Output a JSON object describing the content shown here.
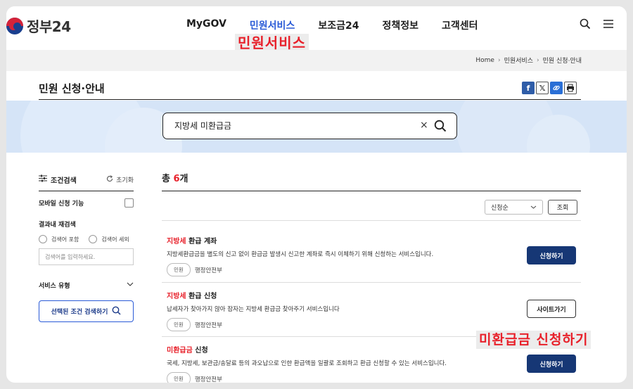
{
  "header": {
    "logo_text": "정부24",
    "nav": [
      "MyGOV",
      "민원서비스",
      "보조금24",
      "정책정보",
      "고객센터"
    ],
    "active_nav": "민원서비스",
    "icons": [
      "search-icon",
      "menu-icon"
    ]
  },
  "annotations": {
    "top": "민원서비스",
    "bottom": "미환급금 신청하기"
  },
  "breadcrumb": [
    "Home",
    "민원서비스",
    "민원 신청·안내"
  ],
  "page": {
    "title": "민원 신청·안내",
    "share_icons": [
      "facebook-icon",
      "x-icon",
      "link-icon",
      "print-icon"
    ]
  },
  "search": {
    "value": "지방세 미환급금",
    "clear": "×"
  },
  "sidebar": {
    "heading": "조건검색",
    "reset": "초기화",
    "mobile_label": "모바일 신청 기능",
    "result_search_label": "결과내 재검색",
    "include_label": "검색어 포함",
    "exclude_label": "검색어 세외",
    "input_placeholder": "검색어를 입력하세요.",
    "service_type_label": "서비스 유형",
    "search_button": "선택된 조건 검색하기"
  },
  "results": {
    "count_prefix": "총 ",
    "count": "6",
    "count_suffix": "개",
    "sort_selected": "신청순",
    "sort_button": "조회",
    "items": [
      {
        "title_hl": "지방세",
        "title_rest": " 환급 계좌",
        "desc": "지방세환급금을 별도의 신고 없이 환급금 발생시 신고한 계좌로 즉시 이체하기 위해 신청하는 서비스입니다.",
        "tag": "민원",
        "org": "행정안전부",
        "button": "신청하기"
      },
      {
        "title_hl": "지방세",
        "title_rest": " 환급 신청",
        "desc": "납세자가 찾아가지 않아 잠자는 지방세 환급금 찾아주기 서비스입니다",
        "tag": "민원",
        "org": "행정안전부",
        "button": "사이트가기"
      },
      {
        "title_hl": "미환급금",
        "title_rest": " 신청",
        "desc": "국세, 지방세, 보관금/송달료 등의 과오납으로 인한 환급액을 일괄로 조회하고 환급 신청할 수 있는 서비스입니다.",
        "tag": "민원",
        "org": "행정안전부",
        "button": "신청하기"
      }
    ]
  }
}
